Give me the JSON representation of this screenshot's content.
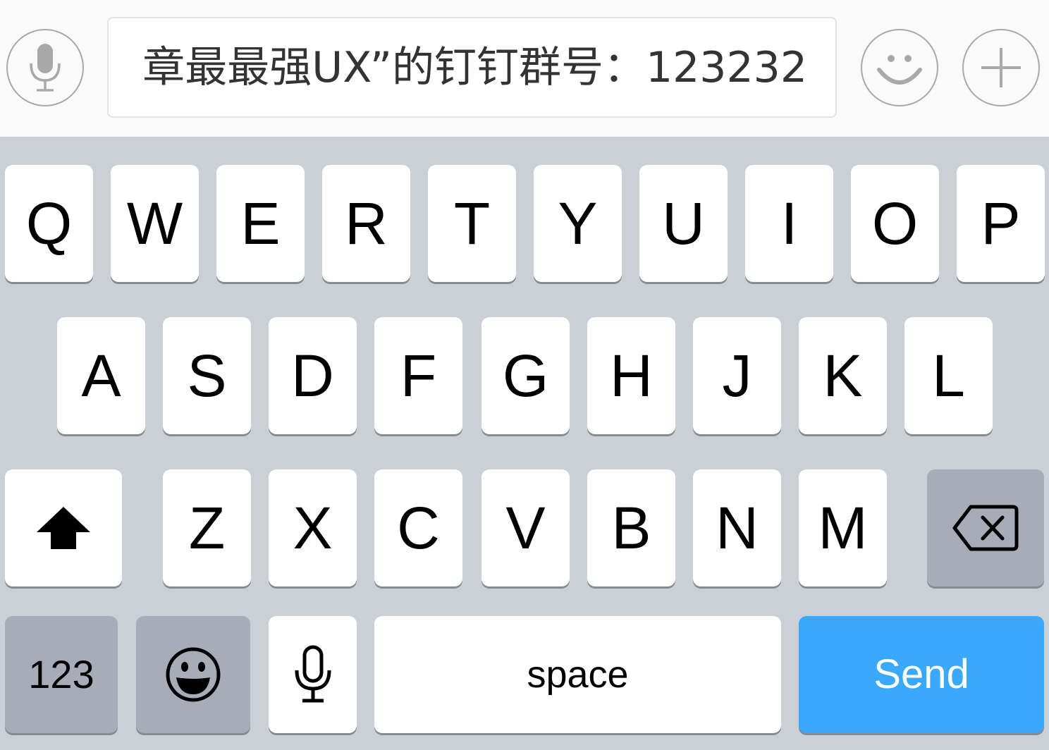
{
  "input_bar": {
    "message_text": "章最最强UX”的钉钉群号：123232",
    "voice_icon": "microphone-icon",
    "emoji_icon": "smiley-face-icon",
    "plus_icon": "plus-icon"
  },
  "keyboard": {
    "row1": [
      "Q",
      "W",
      "E",
      "R",
      "T",
      "Y",
      "U",
      "I",
      "O",
      "P"
    ],
    "row2": [
      "A",
      "S",
      "D",
      "F",
      "G",
      "H",
      "J",
      "K",
      "L"
    ],
    "row3": [
      "Z",
      "X",
      "C",
      "V",
      "B",
      "N",
      "M"
    ],
    "shift_icon": "shift-arrow-icon",
    "delete_icon": "backspace-icon",
    "numbers_label": "123",
    "emoji_key_icon": "emoji-face-icon",
    "dictation_icon": "microphone-icon",
    "space_label": "space",
    "send_label": "Send"
  },
  "colors": {
    "keyboard_background": "#cbd0d6",
    "key_background": "#ffffff",
    "function_key_background": "#a7adb8",
    "send_key_background": "#3aa9fd",
    "input_bar_background": "#fafafa"
  }
}
